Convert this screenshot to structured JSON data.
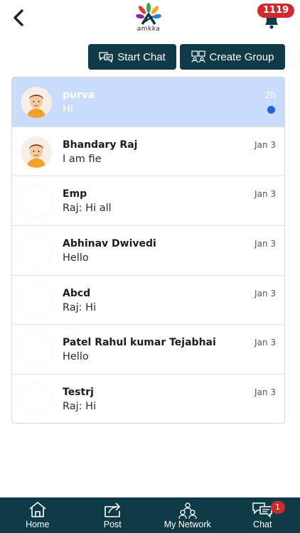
{
  "header": {
    "logo_text": "amkka",
    "notification_count": "1119"
  },
  "actions": {
    "start_chat": "Start Chat",
    "create_group": "Create Group"
  },
  "chats": [
    {
      "name": "purva",
      "message": "Hi",
      "time": "2h",
      "unread": true,
      "avatar": "cartoon-man-avatar"
    },
    {
      "name": "Bhandary Raj",
      "message": "I am fie",
      "time": "Jan 3",
      "unread": false,
      "avatar": "cartoon-man-avatar"
    },
    {
      "name": "Emp",
      "message": "Raj: Hi all",
      "time": "Jan 3",
      "unread": false,
      "avatar": "blank"
    },
    {
      "name": "Abhinav Dwivedi",
      "message": "Hello",
      "time": "Jan 3",
      "unread": false,
      "avatar": "blank"
    },
    {
      "name": "Abcd",
      "message": "Raj: Hi",
      "time": "Jan 3",
      "unread": false,
      "avatar": "blank"
    },
    {
      "name": "Patel Rahul kumar Tejabhai",
      "message": "Hello",
      "time": "Jan 3",
      "unread": false,
      "avatar": "blank"
    },
    {
      "name": "Testrj",
      "message": "Raj: Hi",
      "time": "Jan 3",
      "unread": false,
      "avatar": "blank"
    }
  ],
  "nav": {
    "items": [
      {
        "label": "Home",
        "icon": "home-icon"
      },
      {
        "label": "Post",
        "icon": "share-icon"
      },
      {
        "label": "My Network",
        "icon": "network-icon"
      },
      {
        "label": "Chat",
        "icon": "chat-icon"
      }
    ],
    "chat_badge": "1"
  },
  "colors": {
    "primary": "#0f3a47",
    "active_row": "#c9dcfb",
    "badge": "#d12a2e",
    "unread_dot": "#1f63d6"
  }
}
